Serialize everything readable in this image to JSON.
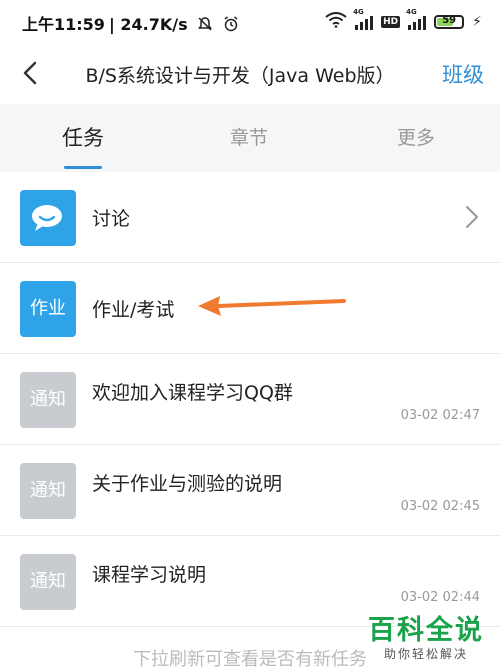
{
  "status_bar": {
    "time": "上午11:59",
    "network_speed": "24.7K/s",
    "signal_tag_1": "4G",
    "hd_badge": "HD",
    "signal_tag_2": "4G",
    "battery_level": "59"
  },
  "header": {
    "title": "B/S系统设计与开发（Java Web版）",
    "class_link": "班级"
  },
  "tabs": [
    {
      "label": "任务",
      "active": true
    },
    {
      "label": "章节",
      "active": false
    },
    {
      "label": "更多",
      "active": false
    }
  ],
  "list": [
    {
      "icon_text": "",
      "icon": "chat-bubble-icon",
      "label": "讨论",
      "time": ""
    },
    {
      "icon_text": "作业",
      "icon": "homework-icon",
      "label": "作业/考试",
      "time": ""
    },
    {
      "icon_text": "通知",
      "icon": "notice-icon",
      "label": "欢迎加入课程学习QQ群",
      "time": "03-02 02:47"
    },
    {
      "icon_text": "通知",
      "icon": "notice-icon",
      "label": "关于作业与测验的说明",
      "time": "03-02 02:45"
    },
    {
      "icon_text": "通知",
      "icon": "notice-icon",
      "label": "课程学习说明",
      "time": "03-02 02:44"
    }
  ],
  "footer_hint": "下拉刷新可查看是否有新任务",
  "watermark": {
    "big": "百科全说",
    "small": "助你轻松解决"
  },
  "colors": {
    "accent": "#2e8fd8",
    "icon_blue": "#2fa3e8",
    "icon_gray": "#c8ccd1",
    "arrow": "#f07a2f",
    "watermark": "#1aa34a"
  }
}
